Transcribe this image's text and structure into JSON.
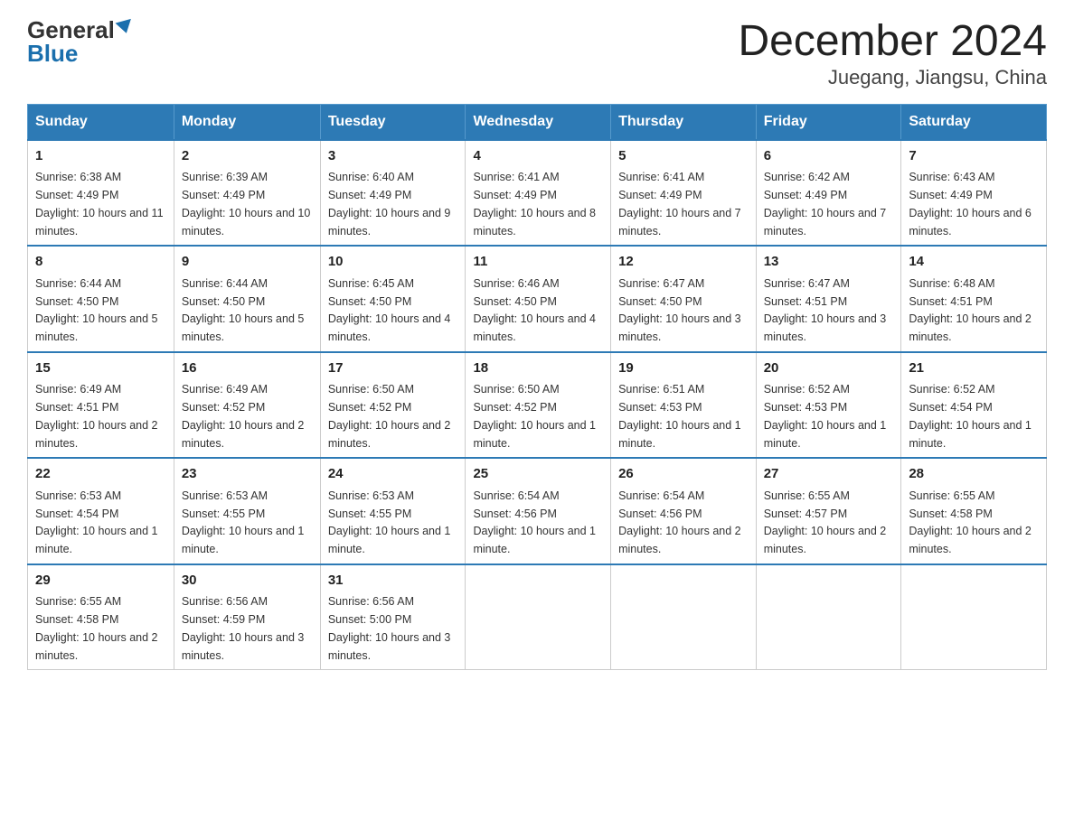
{
  "logo": {
    "text1": "General",
    "text2": "Blue"
  },
  "title": "December 2024",
  "subtitle": "Juegang, Jiangsu, China",
  "days_of_week": [
    "Sunday",
    "Monday",
    "Tuesday",
    "Wednesday",
    "Thursday",
    "Friday",
    "Saturday"
  ],
  "weeks": [
    [
      {
        "day": "1",
        "sunrise": "6:38 AM",
        "sunset": "4:49 PM",
        "daylight": "10 hours and 11 minutes."
      },
      {
        "day": "2",
        "sunrise": "6:39 AM",
        "sunset": "4:49 PM",
        "daylight": "10 hours and 10 minutes."
      },
      {
        "day": "3",
        "sunrise": "6:40 AM",
        "sunset": "4:49 PM",
        "daylight": "10 hours and 9 minutes."
      },
      {
        "day": "4",
        "sunrise": "6:41 AM",
        "sunset": "4:49 PM",
        "daylight": "10 hours and 8 minutes."
      },
      {
        "day": "5",
        "sunrise": "6:41 AM",
        "sunset": "4:49 PM",
        "daylight": "10 hours and 7 minutes."
      },
      {
        "day": "6",
        "sunrise": "6:42 AM",
        "sunset": "4:49 PM",
        "daylight": "10 hours and 7 minutes."
      },
      {
        "day": "7",
        "sunrise": "6:43 AM",
        "sunset": "4:49 PM",
        "daylight": "10 hours and 6 minutes."
      }
    ],
    [
      {
        "day": "8",
        "sunrise": "6:44 AM",
        "sunset": "4:50 PM",
        "daylight": "10 hours and 5 minutes."
      },
      {
        "day": "9",
        "sunrise": "6:44 AM",
        "sunset": "4:50 PM",
        "daylight": "10 hours and 5 minutes."
      },
      {
        "day": "10",
        "sunrise": "6:45 AM",
        "sunset": "4:50 PM",
        "daylight": "10 hours and 4 minutes."
      },
      {
        "day": "11",
        "sunrise": "6:46 AM",
        "sunset": "4:50 PM",
        "daylight": "10 hours and 4 minutes."
      },
      {
        "day": "12",
        "sunrise": "6:47 AM",
        "sunset": "4:50 PM",
        "daylight": "10 hours and 3 minutes."
      },
      {
        "day": "13",
        "sunrise": "6:47 AM",
        "sunset": "4:51 PM",
        "daylight": "10 hours and 3 minutes."
      },
      {
        "day": "14",
        "sunrise": "6:48 AM",
        "sunset": "4:51 PM",
        "daylight": "10 hours and 2 minutes."
      }
    ],
    [
      {
        "day": "15",
        "sunrise": "6:49 AM",
        "sunset": "4:51 PM",
        "daylight": "10 hours and 2 minutes."
      },
      {
        "day": "16",
        "sunrise": "6:49 AM",
        "sunset": "4:52 PM",
        "daylight": "10 hours and 2 minutes."
      },
      {
        "day": "17",
        "sunrise": "6:50 AM",
        "sunset": "4:52 PM",
        "daylight": "10 hours and 2 minutes."
      },
      {
        "day": "18",
        "sunrise": "6:50 AM",
        "sunset": "4:52 PM",
        "daylight": "10 hours and 1 minute."
      },
      {
        "day": "19",
        "sunrise": "6:51 AM",
        "sunset": "4:53 PM",
        "daylight": "10 hours and 1 minute."
      },
      {
        "day": "20",
        "sunrise": "6:52 AM",
        "sunset": "4:53 PM",
        "daylight": "10 hours and 1 minute."
      },
      {
        "day": "21",
        "sunrise": "6:52 AM",
        "sunset": "4:54 PM",
        "daylight": "10 hours and 1 minute."
      }
    ],
    [
      {
        "day": "22",
        "sunrise": "6:53 AM",
        "sunset": "4:54 PM",
        "daylight": "10 hours and 1 minute."
      },
      {
        "day": "23",
        "sunrise": "6:53 AM",
        "sunset": "4:55 PM",
        "daylight": "10 hours and 1 minute."
      },
      {
        "day": "24",
        "sunrise": "6:53 AM",
        "sunset": "4:55 PM",
        "daylight": "10 hours and 1 minute."
      },
      {
        "day": "25",
        "sunrise": "6:54 AM",
        "sunset": "4:56 PM",
        "daylight": "10 hours and 1 minute."
      },
      {
        "day": "26",
        "sunrise": "6:54 AM",
        "sunset": "4:56 PM",
        "daylight": "10 hours and 2 minutes."
      },
      {
        "day": "27",
        "sunrise": "6:55 AM",
        "sunset": "4:57 PM",
        "daylight": "10 hours and 2 minutes."
      },
      {
        "day": "28",
        "sunrise": "6:55 AM",
        "sunset": "4:58 PM",
        "daylight": "10 hours and 2 minutes."
      }
    ],
    [
      {
        "day": "29",
        "sunrise": "6:55 AM",
        "sunset": "4:58 PM",
        "daylight": "10 hours and 2 minutes."
      },
      {
        "day": "30",
        "sunrise": "6:56 AM",
        "sunset": "4:59 PM",
        "daylight": "10 hours and 3 minutes."
      },
      {
        "day": "31",
        "sunrise": "6:56 AM",
        "sunset": "5:00 PM",
        "daylight": "10 hours and 3 minutes."
      },
      null,
      null,
      null,
      null
    ]
  ]
}
